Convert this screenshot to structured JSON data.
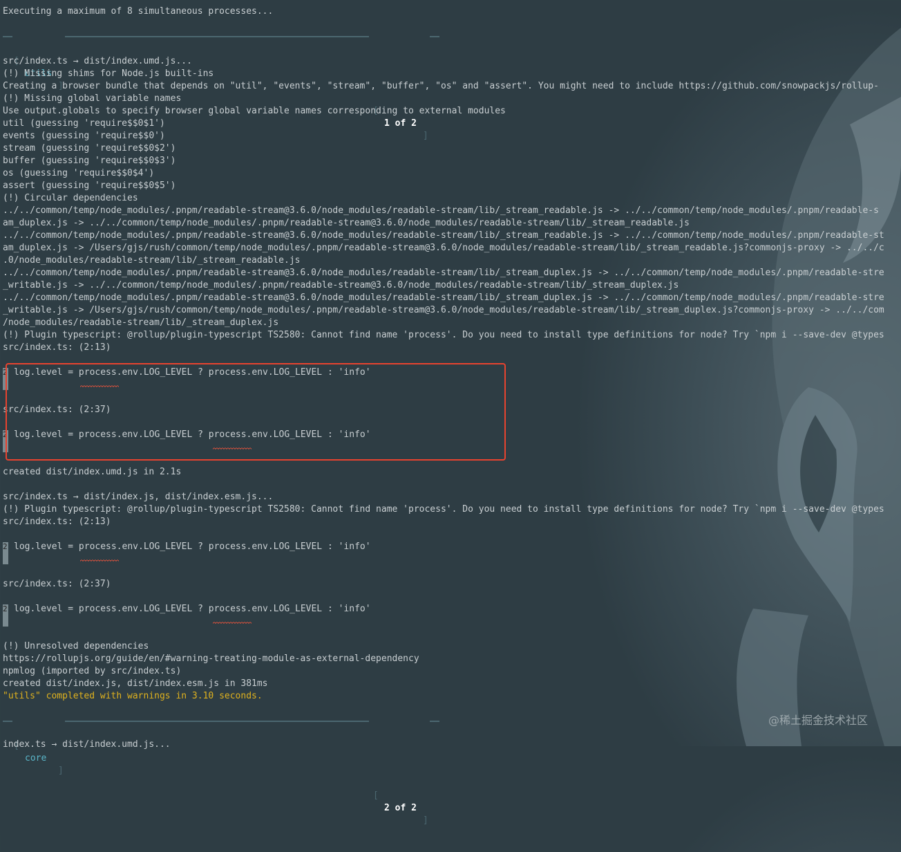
{
  "terminal": {
    "header": "Executing a maximum of 8 simultaneous processes...",
    "project1": {
      "name": "utils",
      "counter": "1 of 2"
    },
    "project2": {
      "name": "core",
      "counter": "2 of 2"
    },
    "lines": {
      "l1": "src/index.ts → dist/index.umd.js...",
      "l2": "(!) Missing shims for Node.js built-ins",
      "l3": "Creating a browser bundle that depends on \"util\", \"events\", \"stream\", \"buffer\", \"os\" and \"assert\". You might need to include https://github.com/snowpackjs/rollup-",
      "l4": "(!) Missing global variable names",
      "l5": "Use output.globals to specify browser global variable names corresponding to external modules",
      "l6": "util (guessing 'require$$0$1')",
      "l7": "events (guessing 'require$$0')",
      "l8": "stream (guessing 'require$$0$2')",
      "l9": "buffer (guessing 'require$$0$3')",
      "l10": "os (guessing 'require$$0$4')",
      "l11": "assert (guessing 'require$$0$5')",
      "l12": "(!) Circular dependencies",
      "l13": "../../common/temp/node_modules/.pnpm/readable-stream@3.6.0/node_modules/readable-stream/lib/_stream_readable.js -> ../../common/temp/node_modules/.pnpm/readable-s",
      "l14": "am_duplex.js -> ../../common/temp/node_modules/.pnpm/readable-stream@3.6.0/node_modules/readable-stream/lib/_stream_readable.js",
      "l15": "../../common/temp/node_modules/.pnpm/readable-stream@3.6.0/node_modules/readable-stream/lib/_stream_readable.js -> ../../common/temp/node_modules/.pnpm/readable-st",
      "l16": "am_duplex.js -> /Users/gjs/rush/common/temp/node_modules/.pnpm/readable-stream@3.6.0/node_modules/readable-stream/lib/_stream_readable.js?commonjs-proxy -> ../../c",
      "l17": ".0/node_modules/readable-stream/lib/_stream_readable.js",
      "l18": "../../common/temp/node_modules/.pnpm/readable-stream@3.6.0/node_modules/readable-stream/lib/_stream_duplex.js -> ../../common/temp/node_modules/.pnpm/readable-stre",
      "l19": "_writable.js -> ../../common/temp/node_modules/.pnpm/readable-stream@3.6.0/node_modules/readable-stream/lib/_stream_duplex.js",
      "l20": "../../common/temp/node_modules/.pnpm/readable-stream@3.6.0/node_modules/readable-stream/lib/_stream_duplex.js -> ../../common/temp/node_modules/.pnpm/readable-stre",
      "l21": "_writable.js -> /Users/gjs/rush/common/temp/node_modules/.pnpm/readable-stream@3.6.0/node_modules/readable-stream/lib/_stream_duplex.js?commonjs-proxy -> ../../com",
      "l22": "/node_modules/readable-stream/lib/_stream_duplex.js",
      "l23": "(!) Plugin typescript: @rollup/plugin-typescript TS2580: Cannot find name 'process'. Do you need to install type definitions for node? Try `npm i --save-dev @types",
      "l24": "src/index.ts: (2:13)",
      "code": "log.level = process.env.LOG_LEVEL ? process.env.LOG_LEVEL : 'info'",
      "l25": "src/index.ts: (2:37)",
      "l26": "created dist/index.umd.js in 2.1s",
      "l27": "src/index.ts → dist/index.js, dist/index.esm.js...",
      "l28": "(!) Plugin typescript: @rollup/plugin-typescript TS2580: Cannot find name 'process'. Do you need to install type definitions for node? Try `npm i --save-dev @types",
      "l29": "src/index.ts: (2:13)",
      "l30": "src/index.ts: (2:37)",
      "l31": "(!) Unresolved dependencies",
      "l32": "https://rollupjs.org/guide/en/#warning-treating-module-as-external-dependency",
      "l33": "npmlog (imported by src/index.ts)",
      "l34": "created dist/index.js, dist/index.esm.js in 381ms",
      "l35": "\"utils\" completed with warnings in 3.10 seconds.",
      "l36": "index.ts → dist/index.umd.js..."
    },
    "gutter_digit": "2"
  },
  "watermark": "@稀土掘金技术社区",
  "colors": {
    "background": "#2d3b42",
    "text": "#c9cfd2",
    "accent_name": "#5ab6c9",
    "warning": "#e0b21e",
    "highlight_box": "#e8432f"
  }
}
